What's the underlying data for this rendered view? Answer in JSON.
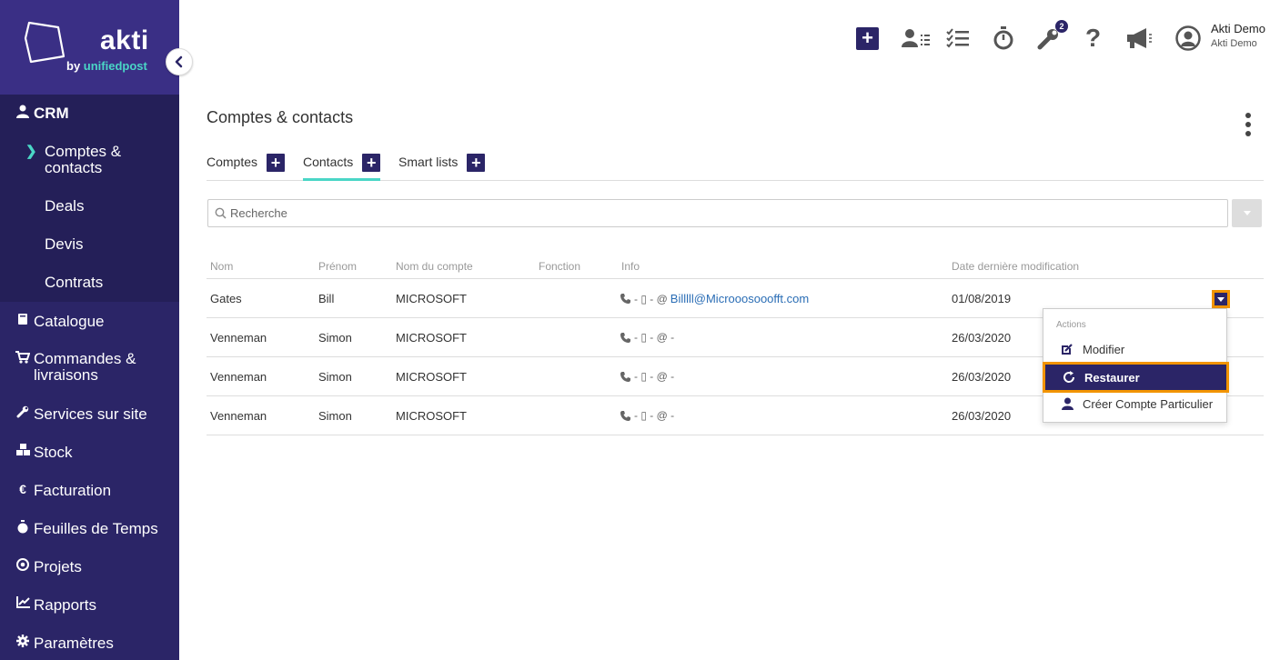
{
  "brand": {
    "name": "akti",
    "sub_prefix": "by ",
    "sub_brand": "unifiedpost",
    "accent": "#4ad6c6",
    "primary": "#2b2567"
  },
  "sidebar": {
    "crm_label": "CRM",
    "crm_items": [
      {
        "label_line1": "Comptes &",
        "label_line2": "contacts",
        "active": true
      },
      {
        "label": "Deals"
      },
      {
        "label": "Devis"
      },
      {
        "label": "Contrats"
      }
    ],
    "items": [
      {
        "label": "Catalogue",
        "icon": "book-icon"
      },
      {
        "label_line1": "Commandes &",
        "label_line2": "livraisons",
        "icon": "cart-icon"
      },
      {
        "label": "Services sur site",
        "icon": "wrench-icon"
      },
      {
        "label": "Stock",
        "icon": "boxes-icon"
      },
      {
        "label": "Facturation",
        "icon": "euro-icon"
      },
      {
        "label": "Feuilles de Temps",
        "icon": "stopwatch-icon"
      },
      {
        "label": "Projets",
        "icon": "target-icon"
      },
      {
        "label": "Rapports",
        "icon": "chart-icon"
      },
      {
        "label": "Paramètres",
        "icon": "gear-icon"
      }
    ]
  },
  "topbar": {
    "notif_badge": "2",
    "user_name": "Akti Demo",
    "user_company": "Akti Demo"
  },
  "page": {
    "title": "Comptes & contacts"
  },
  "tabs": [
    {
      "label": "Comptes",
      "active": false
    },
    {
      "label": "Contacts",
      "active": true
    },
    {
      "label": "Smart lists",
      "active": false
    }
  ],
  "search": {
    "placeholder": "Recherche"
  },
  "table": {
    "columns": [
      "Nom",
      "Prénom",
      "Nom du compte",
      "Fonction",
      "Info",
      "Date dernière modification"
    ],
    "rows": [
      {
        "nom": "Gates",
        "prenom": "Bill",
        "compte": "MICROSOFT",
        "fonction": "",
        "info_prefix": "- ▯ - @",
        "email": "Billlll@Microoosooofft.com",
        "date": "01/08/2019"
      },
      {
        "nom": "Venneman",
        "prenom": "Simon",
        "compte": "MICROSOFT",
        "fonction": "",
        "info_prefix": "- ▯ - @ -",
        "email": "",
        "date": "26/03/2020"
      },
      {
        "nom": "Venneman",
        "prenom": "Simon",
        "compte": "MICROSOFT",
        "fonction": "",
        "info_prefix": "- ▯ - @ -",
        "email": "",
        "date": "26/03/2020"
      },
      {
        "nom": "Venneman",
        "prenom": "Simon",
        "compte": "MICROSOFT",
        "fonction": "",
        "info_prefix": "- ▯ - @ -",
        "email": "",
        "date": "26/03/2020"
      }
    ]
  },
  "actions_menu": {
    "header": "Actions",
    "items": [
      {
        "label": "Modifier",
        "icon": "edit-icon"
      },
      {
        "label": "Restaurer",
        "icon": "restore-icon",
        "highlighted": true
      },
      {
        "label": "Créer Compte Particulier",
        "icon": "person-icon"
      }
    ]
  }
}
